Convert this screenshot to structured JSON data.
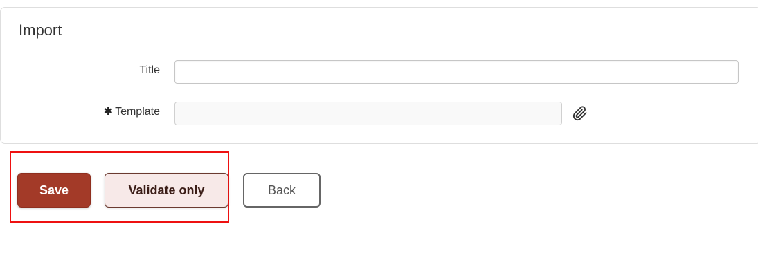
{
  "panel": {
    "title": "Import"
  },
  "form": {
    "title_label": "Title",
    "title_value": "",
    "template_label": "Template",
    "template_required_marker": "✱",
    "template_value": ""
  },
  "icons": {
    "attach": "paperclip-icon"
  },
  "buttons": {
    "save_label": "Save",
    "validate_label": "Validate only",
    "back_label": "Back"
  },
  "colors": {
    "save_bg": "#a33a28",
    "validate_bg": "#f7e9e8",
    "highlight": "#ee1111"
  }
}
